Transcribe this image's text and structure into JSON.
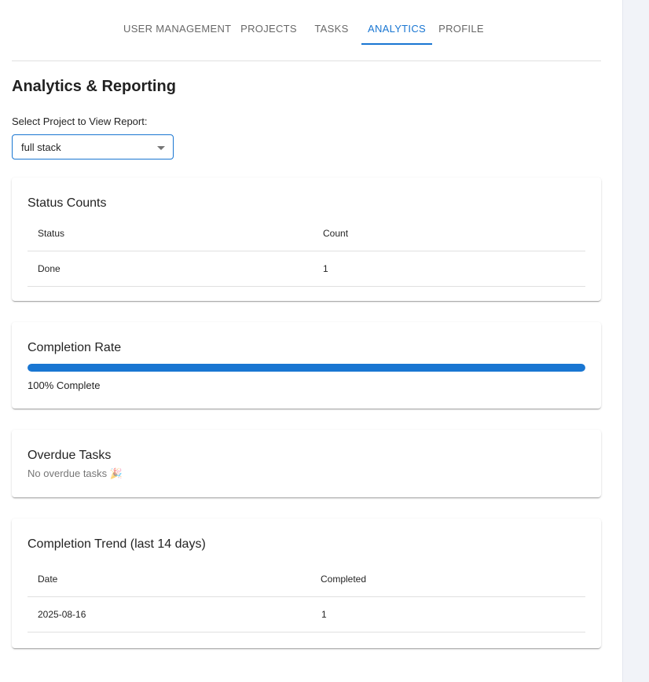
{
  "tabs": [
    {
      "label": "USER MANAGEMENT",
      "active": false
    },
    {
      "label": "PROJECTS",
      "active": false
    },
    {
      "label": "TASKS",
      "active": false
    },
    {
      "label": "ANALYTICS",
      "active": true
    },
    {
      "label": "PROFILE",
      "active": false
    }
  ],
  "page": {
    "title": "Analytics & Reporting",
    "select_label": "Select Project to View Report:",
    "selected_project": "full stack"
  },
  "status_counts": {
    "title": "Status Counts",
    "headers": [
      "Status",
      "Count"
    ],
    "rows": [
      [
        "Done",
        "1"
      ]
    ]
  },
  "completion_rate": {
    "title": "Completion Rate",
    "percent": 100,
    "label": "100% Complete"
  },
  "overdue": {
    "title": "Overdue Tasks",
    "message": "No overdue tasks 🎉"
  },
  "trend": {
    "title": "Completion Trend (last 14 days)",
    "headers": [
      "Date",
      "Completed"
    ],
    "rows": [
      [
        "2025-08-16",
        "1"
      ]
    ]
  },
  "colors": {
    "accent": "#1976d2"
  }
}
